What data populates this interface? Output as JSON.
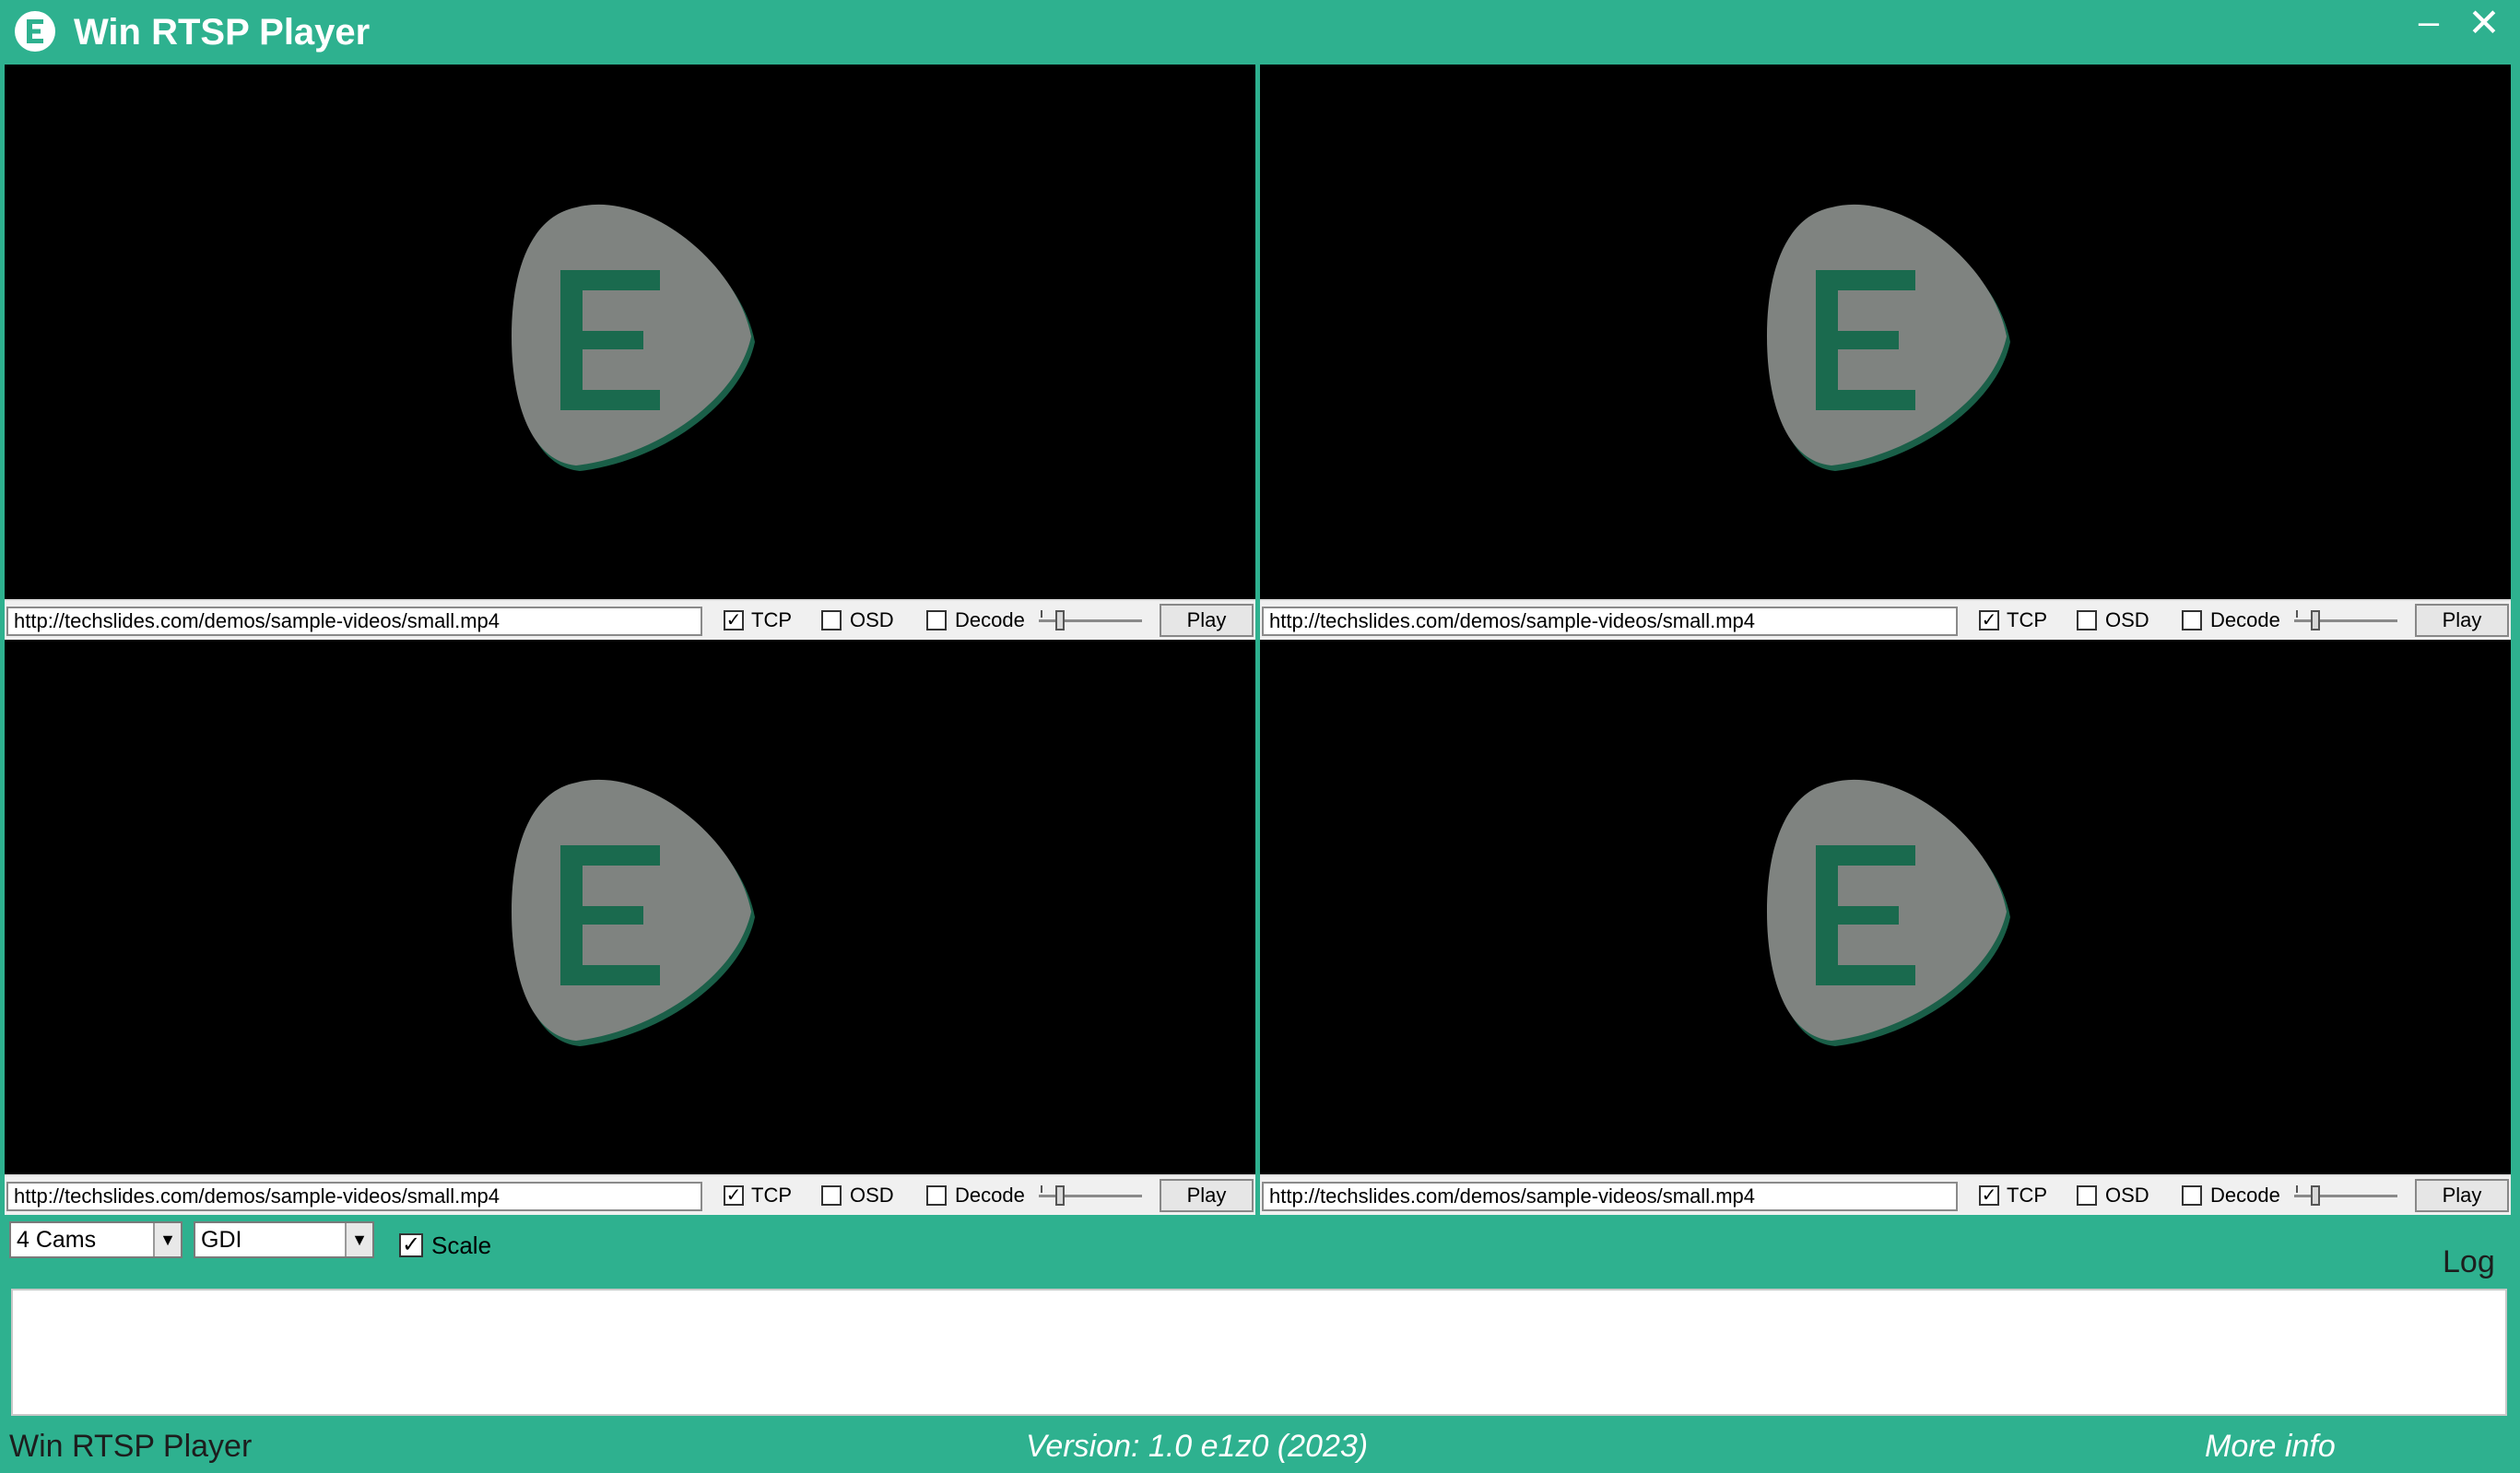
{
  "window": {
    "title": "Win RTSP Player",
    "minimize_glyph": "–",
    "close_glyph": "✕",
    "accent_color": "#2eb18f"
  },
  "panels": [
    {
      "url": "http://techslides.com/demos/sample-videos/small.mp4",
      "tcp_label": "TCP",
      "tcp_checked": true,
      "osd_label": "OSD",
      "osd_checked": false,
      "decode_label": "Decode",
      "decode_checked": false,
      "play_label": "Play"
    },
    {
      "url": "http://techslides.com/demos/sample-videos/small.mp4",
      "tcp_label": "TCP",
      "tcp_checked": true,
      "osd_label": "OSD",
      "osd_checked": false,
      "decode_label": "Decode",
      "decode_checked": false,
      "play_label": "Play"
    },
    {
      "url": "http://techslides.com/demos/sample-videos/small.mp4",
      "tcp_label": "TCP",
      "tcp_checked": true,
      "osd_label": "OSD",
      "osd_checked": false,
      "decode_label": "Decode",
      "decode_checked": false,
      "play_label": "Play"
    },
    {
      "url": "http://techslides.com/demos/sample-videos/small.mp4",
      "tcp_label": "TCP",
      "tcp_checked": true,
      "osd_label": "OSD",
      "osd_checked": false,
      "decode_label": "Decode",
      "decode_checked": false,
      "play_label": "Play"
    }
  ],
  "controls": {
    "cams_select": "4 Cams",
    "renderer_select": "GDI",
    "scale_label": "Scale",
    "scale_checked": true,
    "log_label": "Log",
    "log_text": ""
  },
  "status": {
    "app_name": "Win RTSP Player",
    "version": "Version: 1.0 e1z0 (2023)",
    "more_info": "More info"
  },
  "icons": {
    "app_logo": "e-logo-icon",
    "placeholder": "e-pick-logo-icon",
    "combo_arrow": "chevron-down-icon",
    "checkbox_mark": "✓"
  }
}
